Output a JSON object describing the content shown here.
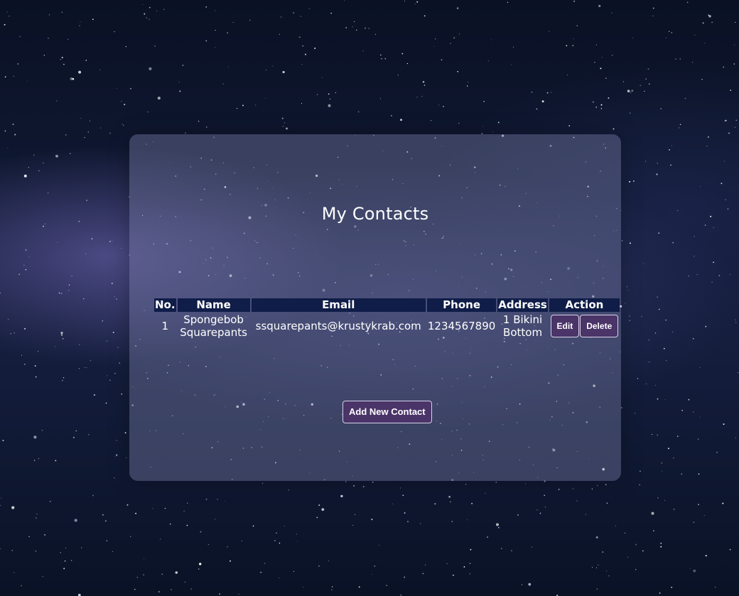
{
  "page": {
    "title": "My Contacts"
  },
  "table": {
    "headers": [
      "No.",
      "Name",
      "Email",
      "Phone",
      "Address",
      "Action"
    ],
    "rows": [
      {
        "no": "1",
        "name": "Spongebob Squarepants",
        "email": "ssquarepants@krustykrab.com",
        "phone": "1234567890",
        "address": "1 Bikini Bottom",
        "edit_label": "Edit",
        "delete_label": "Delete"
      }
    ]
  },
  "actions": {
    "add_label": "Add New Contact"
  },
  "colors": {
    "header_bg": "#0f1d48",
    "button_bg": "#4a3468",
    "panel_bg": "rgba(120,125,165,0.42)"
  }
}
